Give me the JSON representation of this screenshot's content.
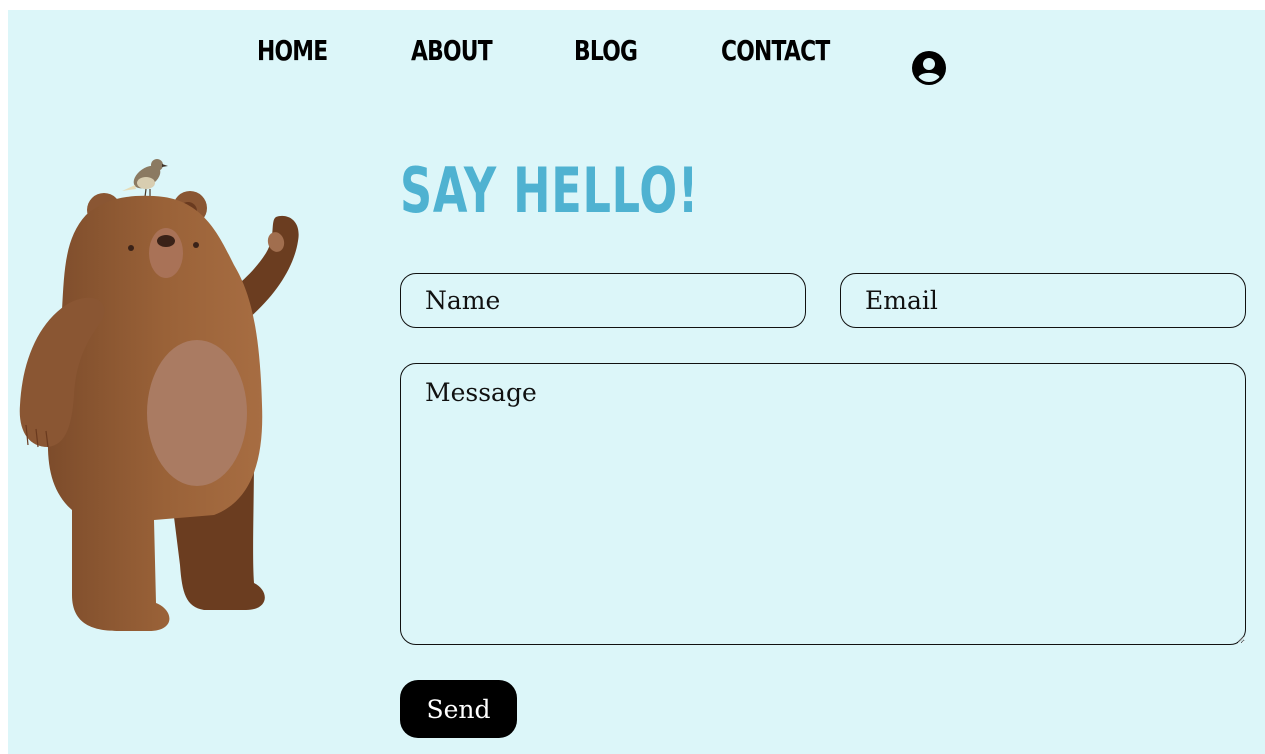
{
  "nav": {
    "items": [
      {
        "label": "HOME"
      },
      {
        "label": "ABOUT"
      },
      {
        "label": "BLOG"
      },
      {
        "label": "CONTACT"
      }
    ],
    "profile_icon": "account-circle-icon"
  },
  "illustration": {
    "name": "waving-bear-with-bird"
  },
  "contact": {
    "title": "SAY HELLO!",
    "name_placeholder": "Name",
    "email_placeholder": "Email",
    "message_placeholder": "Message",
    "send_label": "Send"
  },
  "colors": {
    "background": "#dcf6f9",
    "title": "#4fb2d1",
    "button": "#000000"
  }
}
